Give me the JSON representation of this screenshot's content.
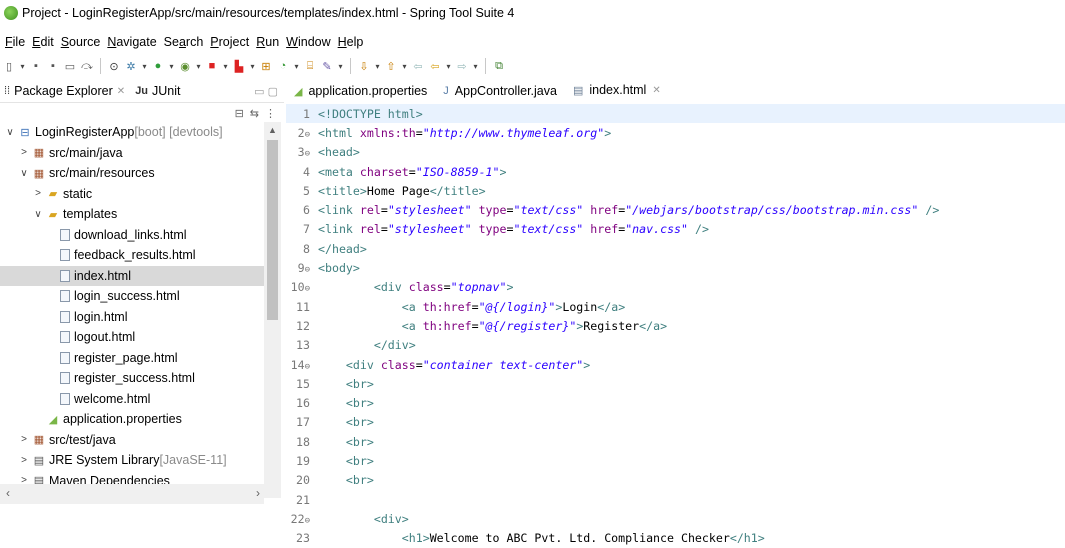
{
  "window": {
    "title": "Project - LoginRegisterApp/src/main/resources/templates/index.html - Spring Tool Suite 4"
  },
  "menu": [
    {
      "label": "File",
      "u": "F",
      "rest": "ile"
    },
    {
      "label": "Edit",
      "u": "E",
      "rest": "dit"
    },
    {
      "label": "Source",
      "u": "S",
      "rest": "ource"
    },
    {
      "label": "Navigate",
      "u": "N",
      "rest": "avigate"
    },
    {
      "label": "Search",
      "u": "a",
      "pre": "Se",
      "rest": "rch"
    },
    {
      "label": "Project",
      "u": "P",
      "rest": "roject"
    },
    {
      "label": "Run",
      "u": "R",
      "rest": "un"
    },
    {
      "label": "Window",
      "u": "W",
      "rest": "indow"
    },
    {
      "label": "Help",
      "u": "H",
      "rest": "elp"
    }
  ],
  "left_tabs": {
    "package_explorer": "Package Explorer",
    "package_explorer_close": "✕",
    "junit": "JUnit",
    "junit_icon": "Ju"
  },
  "tree": [
    {
      "indent": 0,
      "twisty": "∨",
      "icon": "proj",
      "label": "LoginRegisterApp",
      "suffix": " [boot] [devtools]"
    },
    {
      "indent": 1,
      "twisty": ">",
      "icon": "pkg",
      "label": "src/main/java"
    },
    {
      "indent": 1,
      "twisty": "∨",
      "icon": "pkg",
      "label": "src/main/resources"
    },
    {
      "indent": 2,
      "twisty": ">",
      "icon": "folder",
      "label": "static"
    },
    {
      "indent": 2,
      "twisty": "∨",
      "icon": "folder",
      "label": "templates"
    },
    {
      "indent": 3,
      "twisty": "",
      "icon": "file",
      "label": "download_links.html"
    },
    {
      "indent": 3,
      "twisty": "",
      "icon": "file",
      "label": "feedback_results.html"
    },
    {
      "indent": 3,
      "twisty": "",
      "icon": "file",
      "label": "index.html",
      "selected": true
    },
    {
      "indent": 3,
      "twisty": "",
      "icon": "file",
      "label": "login_success.html"
    },
    {
      "indent": 3,
      "twisty": "",
      "icon": "file",
      "label": "login.html"
    },
    {
      "indent": 3,
      "twisty": "",
      "icon": "file",
      "label": "logout.html"
    },
    {
      "indent": 3,
      "twisty": "",
      "icon": "file",
      "label": "register_page.html"
    },
    {
      "indent": 3,
      "twisty": "",
      "icon": "file",
      "label": "register_success.html"
    },
    {
      "indent": 3,
      "twisty": "",
      "icon": "file",
      "label": "welcome.html"
    },
    {
      "indent": 2,
      "twisty": "",
      "icon": "leaf",
      "label": "application.properties"
    },
    {
      "indent": 1,
      "twisty": ">",
      "icon": "pkg",
      "label": "src/test/java"
    },
    {
      "indent": 1,
      "twisty": ">",
      "icon": "lib",
      "label": "JRE System Library",
      "suffix": " [JavaSE-11]"
    },
    {
      "indent": 1,
      "twisty": ">",
      "icon": "lib",
      "label": "Maven Dependencies"
    }
  ],
  "editor_tabs": [
    {
      "label": "application.properties",
      "icon": "leaf"
    },
    {
      "label": "AppController.java",
      "icon": "java"
    },
    {
      "label": "index.html",
      "icon": "file",
      "active": true,
      "close": "✕"
    }
  ],
  "code": [
    {
      "n": "1",
      "fold": "",
      "current": true,
      "parts": [
        [
          "doctype",
          "<!DOCTYPE html>"
        ]
      ]
    },
    {
      "n": "2",
      "fold": "⊖",
      "parts": [
        [
          "tag",
          "<html "
        ],
        [
          "attr",
          "xmlns:th"
        ],
        [
          "txt",
          "="
        ],
        [
          "val",
          "\"http://www.thymeleaf.org\""
        ],
        [
          "tag",
          ">"
        ]
      ]
    },
    {
      "n": "3",
      "fold": "⊖",
      "parts": [
        [
          "tag",
          "<head>"
        ]
      ]
    },
    {
      "n": "4",
      "fold": "",
      "parts": [
        [
          "tag",
          "<meta "
        ],
        [
          "attr",
          "charset"
        ],
        [
          "txt",
          "="
        ],
        [
          "val",
          "\"ISO-8859-1\""
        ],
        [
          "tag",
          ">"
        ]
      ]
    },
    {
      "n": "5",
      "fold": "",
      "parts": [
        [
          "tag",
          "<title>"
        ],
        [
          "txt",
          "Home Page"
        ],
        [
          "tag",
          "</title>"
        ]
      ]
    },
    {
      "n": "6",
      "fold": "",
      "parts": [
        [
          "tag",
          "<link "
        ],
        [
          "attr",
          "rel"
        ],
        [
          "txt",
          "="
        ],
        [
          "val",
          "\"stylesheet\""
        ],
        [
          "txt",
          " "
        ],
        [
          "attr",
          "type"
        ],
        [
          "txt",
          "="
        ],
        [
          "val",
          "\"text/css\""
        ],
        [
          "txt",
          " "
        ],
        [
          "attr",
          "href"
        ],
        [
          "txt",
          "="
        ],
        [
          "val",
          "\"/webjars/bootstrap/css/bootstrap.min.css\""
        ],
        [
          "txt",
          " "
        ],
        [
          "tag",
          "/>"
        ]
      ]
    },
    {
      "n": "7",
      "fold": "",
      "parts": [
        [
          "tag",
          "<link "
        ],
        [
          "attr",
          "rel"
        ],
        [
          "txt",
          "="
        ],
        [
          "val",
          "\"stylesheet\""
        ],
        [
          "txt",
          " "
        ],
        [
          "attr",
          "type"
        ],
        [
          "txt",
          "="
        ],
        [
          "val",
          "\"text/css\""
        ],
        [
          "txt",
          " "
        ],
        [
          "attr",
          "href"
        ],
        [
          "txt",
          "="
        ],
        [
          "val",
          "\"nav.css\""
        ],
        [
          "txt",
          " "
        ],
        [
          "tag",
          "/>"
        ]
      ]
    },
    {
      "n": "8",
      "fold": "",
      "parts": [
        [
          "tag",
          "</head>"
        ]
      ]
    },
    {
      "n": "9",
      "fold": "⊖",
      "parts": [
        [
          "tag",
          "<body>"
        ]
      ]
    },
    {
      "n": "10",
      "fold": "⊖",
      "parts": [
        [
          "txt",
          "        "
        ],
        [
          "tag",
          "<div "
        ],
        [
          "attr",
          "class"
        ],
        [
          "txt",
          "="
        ],
        [
          "val",
          "\"topnav\""
        ],
        [
          "tag",
          ">"
        ]
      ]
    },
    {
      "n": "11",
      "fold": "",
      "parts": [
        [
          "txt",
          "            "
        ],
        [
          "tag",
          "<a "
        ],
        [
          "attr",
          "th:href"
        ],
        [
          "txt",
          "="
        ],
        [
          "val",
          "\"@{/login}\""
        ],
        [
          "tag",
          ">"
        ],
        [
          "txt",
          "Login"
        ],
        [
          "tag",
          "</a>"
        ]
      ]
    },
    {
      "n": "12",
      "fold": "",
      "parts": [
        [
          "txt",
          "            "
        ],
        [
          "tag",
          "<a "
        ],
        [
          "attr",
          "th:href"
        ],
        [
          "txt",
          "="
        ],
        [
          "val",
          "\"@{/register}\""
        ],
        [
          "tag",
          ">"
        ],
        [
          "txt",
          "Register"
        ],
        [
          "tag",
          "</a>"
        ]
      ]
    },
    {
      "n": "13",
      "fold": "",
      "parts": [
        [
          "txt",
          "        "
        ],
        [
          "tag",
          "</div>"
        ]
      ]
    },
    {
      "n": "14",
      "fold": "⊖",
      "parts": [
        [
          "txt",
          "    "
        ],
        [
          "tag",
          "<div "
        ],
        [
          "attr",
          "class"
        ],
        [
          "txt",
          "="
        ],
        [
          "val",
          "\"container text-center\""
        ],
        [
          "tag",
          ">"
        ]
      ]
    },
    {
      "n": "15",
      "fold": "",
      "parts": [
        [
          "txt",
          "    "
        ],
        [
          "tag",
          "<br>"
        ]
      ]
    },
    {
      "n": "16",
      "fold": "",
      "parts": [
        [
          "txt",
          "    "
        ],
        [
          "tag",
          "<br>"
        ]
      ]
    },
    {
      "n": "17",
      "fold": "",
      "parts": [
        [
          "txt",
          "    "
        ],
        [
          "tag",
          "<br>"
        ]
      ]
    },
    {
      "n": "18",
      "fold": "",
      "parts": [
        [
          "txt",
          "    "
        ],
        [
          "tag",
          "<br>"
        ]
      ]
    },
    {
      "n": "19",
      "fold": "",
      "parts": [
        [
          "txt",
          "    "
        ],
        [
          "tag",
          "<br>"
        ]
      ]
    },
    {
      "n": "20",
      "fold": "",
      "parts": [
        [
          "txt",
          "    "
        ],
        [
          "tag",
          "<br>"
        ]
      ]
    },
    {
      "n": "21",
      "fold": "",
      "parts": []
    },
    {
      "n": "22",
      "fold": "⊖",
      "parts": [
        [
          "txt",
          "        "
        ],
        [
          "tag",
          "<div>"
        ]
      ]
    },
    {
      "n": "23",
      "fold": "",
      "parts": [
        [
          "txt",
          "            "
        ],
        [
          "tag",
          "<h1>"
        ],
        [
          "txt",
          "Welcome to ABC Pvt. Ltd. Compliance Checker"
        ],
        [
          "tag",
          "</h1>"
        ]
      ]
    }
  ]
}
